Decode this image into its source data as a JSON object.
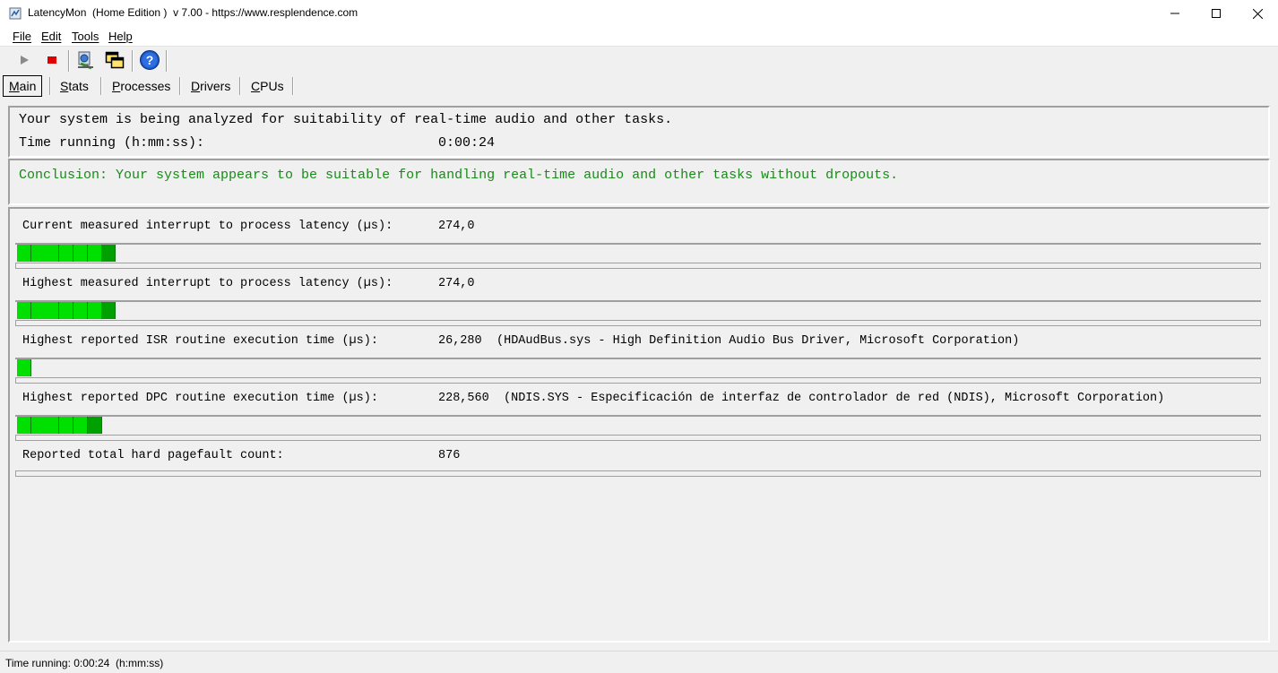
{
  "window": {
    "title": "LatencyMon  (Home Edition )  v 7.00 - https://www.resplendence.com",
    "app_icon": "latencymon-app-icon"
  },
  "menu": [
    "File",
    "Edit",
    "Tools",
    "Help"
  ],
  "toolbar": {
    "buttons": [
      "play-icon",
      "stop-icon",
      "kernel-timer-icon",
      "windows-overlap-icon",
      "help-icon"
    ]
  },
  "tabs": [
    "Main",
    "Stats",
    "Processes",
    "Drivers",
    "CPUs"
  ],
  "active_tab": "Main",
  "status_panel": {
    "analysis_text": "Your system is being analyzed for suitability of real-time audio and other tasks.",
    "time_label": "Time running (h:mm:ss):",
    "time_value": "0:00:24"
  },
  "conclusion": {
    "text": "Conclusion: Your system appears to be suitable for handling real-time audio and other tasks without dropouts.",
    "color": "#1a8a1a"
  },
  "metrics": [
    {
      "label": "Current measured interrupt to process latency (µs):",
      "value": "274,0",
      "detail": "",
      "bar_segments": 7
    },
    {
      "label": "Highest measured interrupt to process latency (µs):",
      "value": "274,0",
      "detail": "",
      "bar_segments": 7
    },
    {
      "label": "Highest reported ISR routine execution time (µs):",
      "value": "26,280",
      "detail": "(HDAudBus.sys - High Definition Audio Bus Driver, Microsoft Corporation)",
      "bar_segments": 1
    },
    {
      "label": "Highest reported DPC routine execution time (µs):",
      "value": "228,560",
      "detail": "(NDIS.SYS - Especificación de interfaz de controlador de red (NDIS), Microsoft Corporation)",
      "bar_segments": 6
    },
    {
      "label": "Reported total hard pagefault count:",
      "value": "876",
      "detail": "",
      "bar_segments": 0
    }
  ],
  "colors": {
    "bar_green": "#00e000",
    "bar_dark": "#00a000"
  },
  "statusbar": {
    "text": "Time running: 0:00:24  (h:mm:ss)"
  }
}
